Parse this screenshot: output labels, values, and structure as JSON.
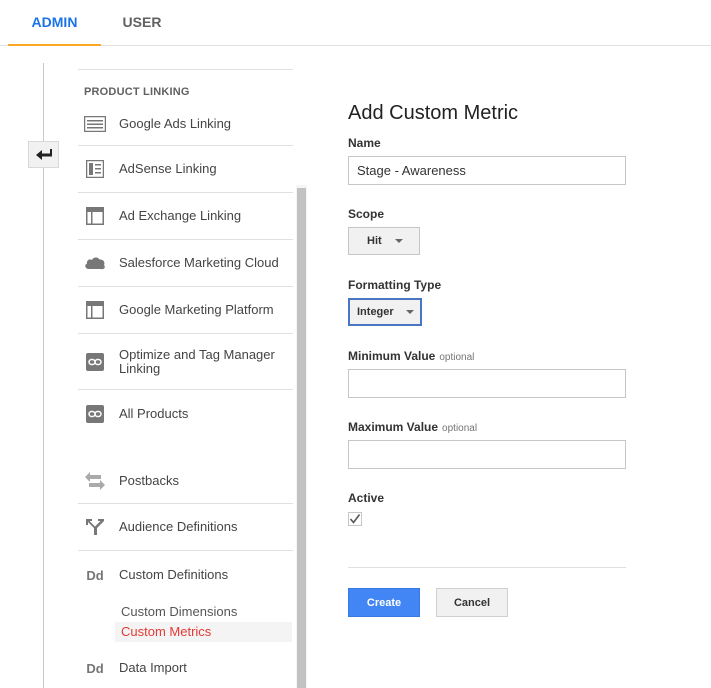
{
  "tabs": [
    {
      "label": "ADMIN",
      "active": true
    },
    {
      "label": "USER",
      "active": false
    }
  ],
  "nav": {
    "section_title": "PRODUCT LINKING",
    "items": [
      {
        "label": "Google Ads Linking",
        "icon": "ads-icon"
      },
      {
        "label": "AdSense Linking",
        "icon": "adsense-icon"
      },
      {
        "label": "Ad Exchange Linking",
        "icon": "ad-exchange-icon"
      },
      {
        "label": "Salesforce Marketing Cloud",
        "icon": "cloud-icon"
      },
      {
        "label": "Google Marketing Platform",
        "icon": "marketing-platform-icon"
      },
      {
        "label": "Optimize and Tag Manager Linking",
        "icon": "link-icon"
      },
      {
        "label": "All Products",
        "icon": "link-icon"
      },
      {
        "label": "Postbacks",
        "icon": "postbacks-icon"
      },
      {
        "label": "Audience Definitions",
        "icon": "audience-icon"
      },
      {
        "label": "Custom Definitions",
        "icon": "dd-icon",
        "glyph": "Dd"
      },
      {
        "label": "Data Import",
        "icon": "dd-icon",
        "glyph": "Dd"
      }
    ],
    "sub_items": [
      {
        "label": "Custom Dimensions",
        "active": false
      },
      {
        "label": "Custom Metrics",
        "active": true
      }
    ]
  },
  "form": {
    "title": "Add Custom Metric",
    "name_label": "Name",
    "name_value": "Stage - Awareness",
    "scope_label": "Scope",
    "scope_value": "Hit",
    "formatting_label": "Formatting Type",
    "formatting_value": "Integer",
    "min_label": "Minimum Value",
    "min_optional": "optional",
    "min_value": "",
    "max_label": "Maximum Value",
    "max_optional": "optional",
    "max_value": "",
    "active_label": "Active",
    "active_checked": true,
    "create_label": "Create",
    "cancel_label": "Cancel"
  },
  "colors": {
    "accent_blue": "#1a73e8",
    "tab_underline": "#f9a825",
    "create_button": "#4285f4",
    "active_sub_item": "#e53935"
  }
}
